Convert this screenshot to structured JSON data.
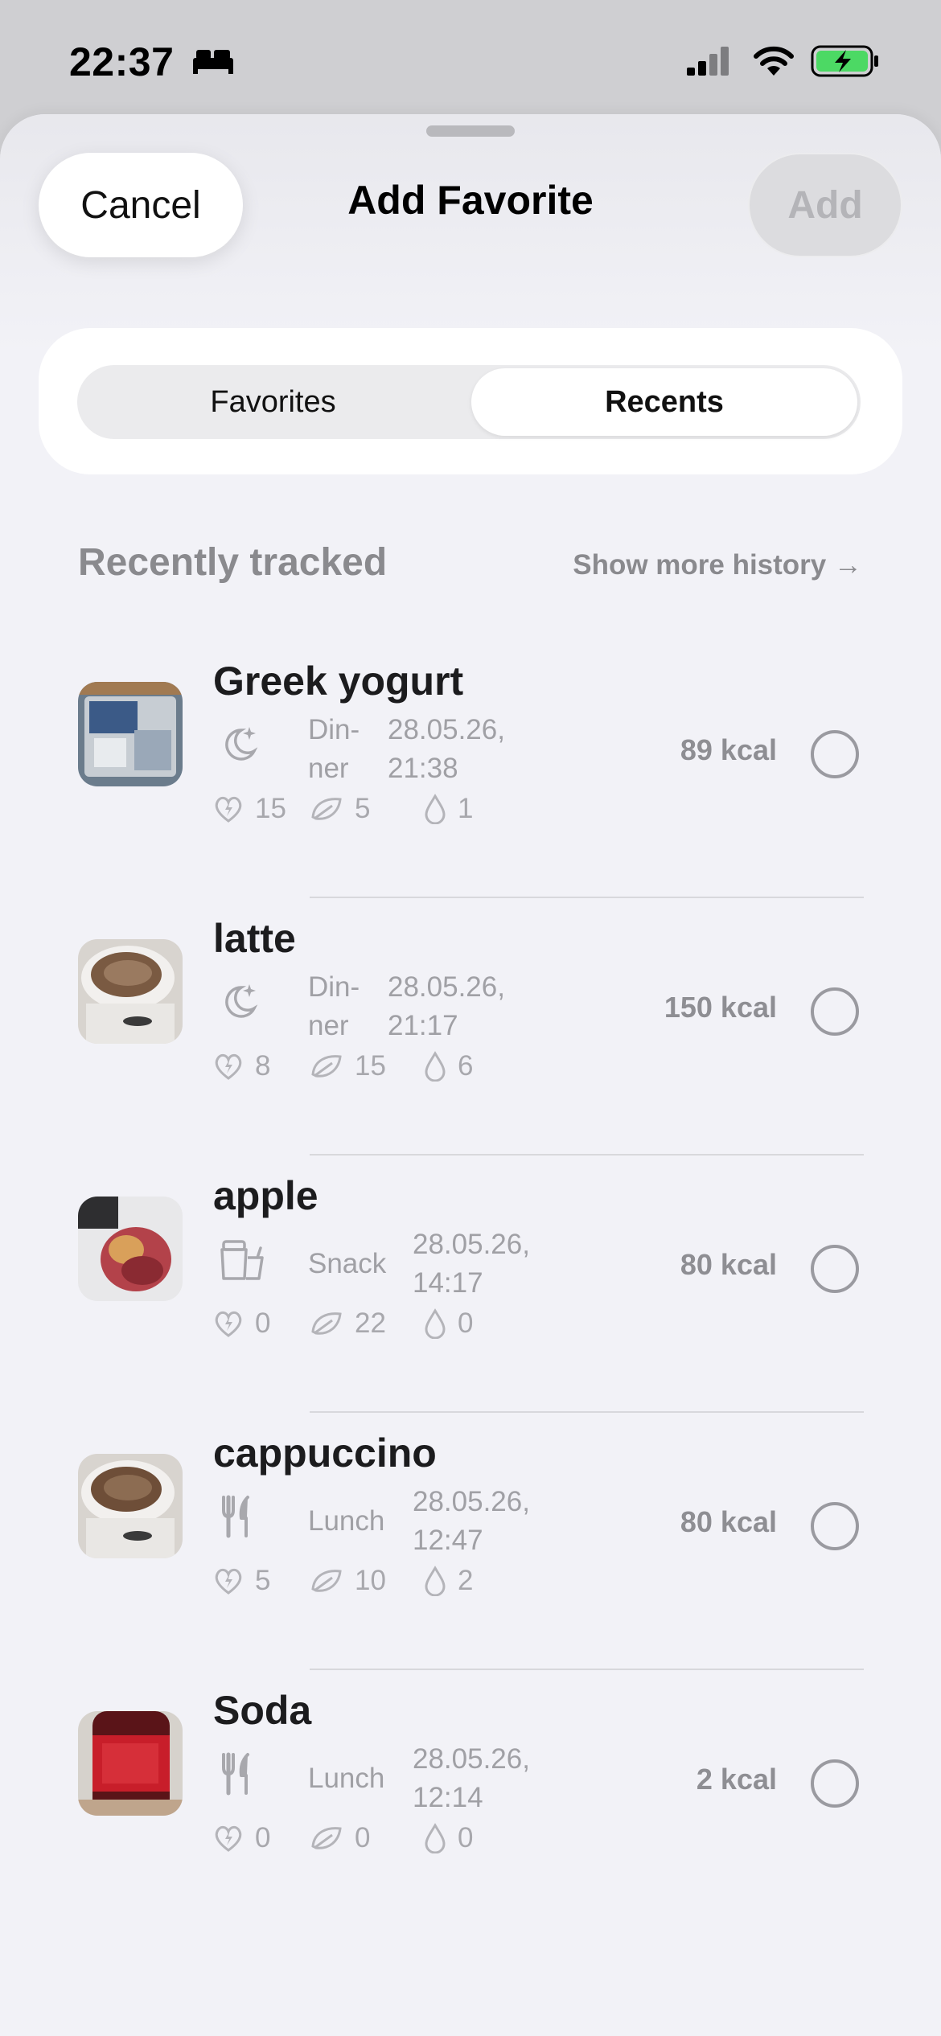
{
  "status_bar": {
    "time": "22:37"
  },
  "header": {
    "cancel_label": "Cancel",
    "title": "Add Favorite",
    "add_label": "Add"
  },
  "segmented": {
    "tabs": [
      "Favorites",
      "Recents"
    ],
    "selected": "Recents"
  },
  "section": {
    "title": "Recently tracked",
    "more_link": "Show more history →"
  },
  "items": [
    {
      "name": "Greek yogurt",
      "meal_line1": "Din-",
      "meal_line2": "ner",
      "date_line1": "28.05.26,",
      "date_line2": "21:38",
      "kcal": "89 kcal",
      "protein": "15",
      "carbs": "5",
      "fat": "1",
      "meal_icon": "moon-stars-icon",
      "selected": false
    },
    {
      "name": "latte",
      "meal_line1": "Din-",
      "meal_line2": "ner",
      "date_line1": "28.05.26,",
      "date_line2": "21:17",
      "kcal": "150 kcal",
      "protein": "8",
      "carbs": "15",
      "fat": "6",
      "meal_icon": "moon-stars-icon",
      "selected": false
    },
    {
      "name": "apple",
      "meal_line1": "Snack",
      "meal_line2": "",
      "date_line1": "28.05.26,",
      "date_line2": "14:17",
      "kcal": "80 kcal",
      "protein": "0",
      "carbs": "22",
      "fat": "0",
      "meal_icon": "snack-jar-icon",
      "selected": false
    },
    {
      "name": "cappuccino",
      "meal_line1": "Lunch",
      "meal_line2": "",
      "date_line1": "28.05.26,",
      "date_line2": "12:47",
      "kcal": "80 kcal",
      "protein": "5",
      "carbs": "10",
      "fat": "2",
      "meal_icon": "fork-knife-icon",
      "selected": false
    },
    {
      "name": "Soda",
      "meal_line1": "Lunch",
      "meal_line2": "",
      "date_line1": "28.05.26,",
      "date_line2": "12:14",
      "kcal": "2 kcal",
      "protein": "0",
      "carbs": "0",
      "fat": "0",
      "meal_icon": "fork-knife-icon",
      "selected": false
    }
  ],
  "colors": {
    "sheet_background": "#f2f2f7",
    "secondary_text": "#8e8e93",
    "battery_green": "#4cd964"
  }
}
